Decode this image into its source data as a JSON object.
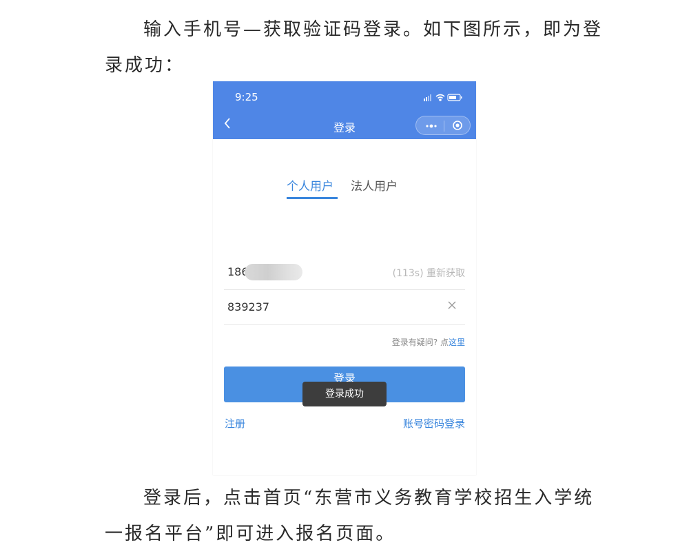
{
  "document": {
    "paragraph1": {
      "line1": "输入手机号—获取验证码登录。如下图所示，即为登",
      "line2": "录成功："
    },
    "paragraph2": {
      "line1": "登录后，点击首页“东营市义务教育学校招生入学统",
      "line2": "一报名平台”即可进入报名页面。"
    }
  },
  "screenshot": {
    "status_bar": {
      "time": "9:25",
      "icons": [
        "signal-icon",
        "wifi-icon",
        "battery-icon"
      ]
    },
    "nav": {
      "back_icon": "chevron-left-icon",
      "title": "登录",
      "menu_icon": "more-dots-icon",
      "close_icon": "target-icon"
    },
    "tabs": [
      {
        "label": "个人用户",
        "active": true
      },
      {
        "label": "法人用户",
        "active": false
      }
    ],
    "phone_field": {
      "value": "186",
      "resend": "(113s) 重新获取"
    },
    "code_field": {
      "value": "839237"
    },
    "help": {
      "text": "登录有疑问? 点",
      "link": "这里"
    },
    "login_button": {
      "label": "登录"
    },
    "toast": {
      "text": "登录成功"
    },
    "links": {
      "register": "注册",
      "password_login": "账号密码登录"
    },
    "colors": {
      "header": "#4f86e6",
      "accent": "#3a86dd",
      "button": "#4a90e2",
      "toast": "#3d3d3d"
    }
  }
}
